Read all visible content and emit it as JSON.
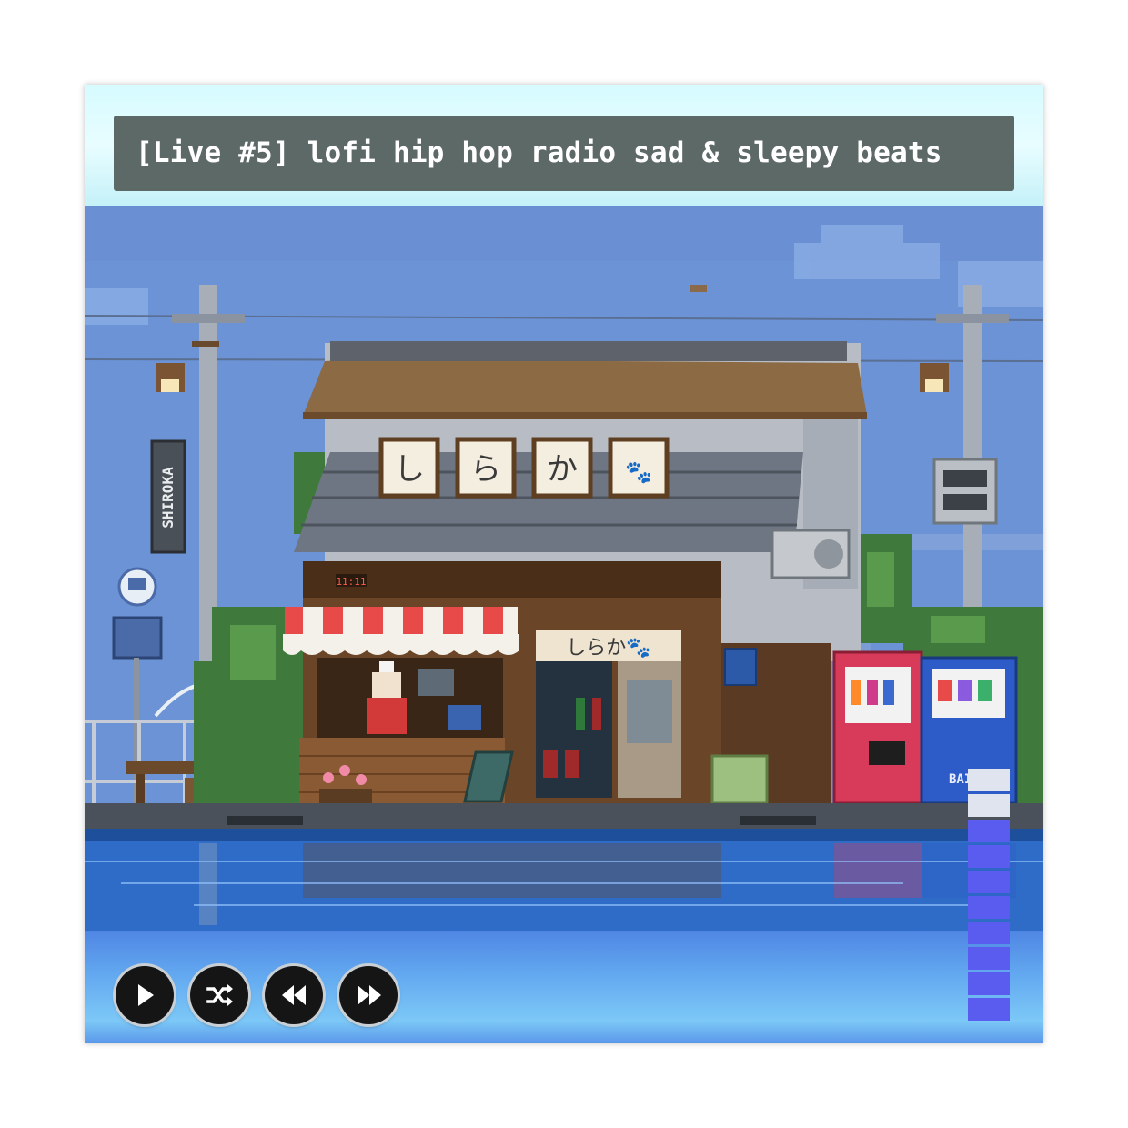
{
  "title": "[Live #5] lofi hip hop radio sad & sleepy beats",
  "scene": {
    "sign": "SHIROKA",
    "shop_sign_chars": [
      "し",
      "ら",
      "か",
      "🐾"
    ],
    "noren_text": "しらか🐾",
    "clock": "11:11",
    "vending_label": "BAI"
  },
  "controls": [
    {
      "name": "play-button",
      "icon": "play-icon"
    },
    {
      "name": "shuffle-button",
      "icon": "shuffle-icon"
    },
    {
      "name": "previous-button",
      "icon": "rewind-icon"
    },
    {
      "name": "next-button",
      "icon": "fast-forward-icon"
    }
  ],
  "volume": {
    "segments": 10,
    "filled_fraction": 0.8
  },
  "colors": {
    "title_bg": "#5d6967",
    "header_bg": "#d6fbff",
    "volume_on": "#5a5cf0",
    "volume_off": "#dfe4ee",
    "sky": "#6b93d6"
  }
}
